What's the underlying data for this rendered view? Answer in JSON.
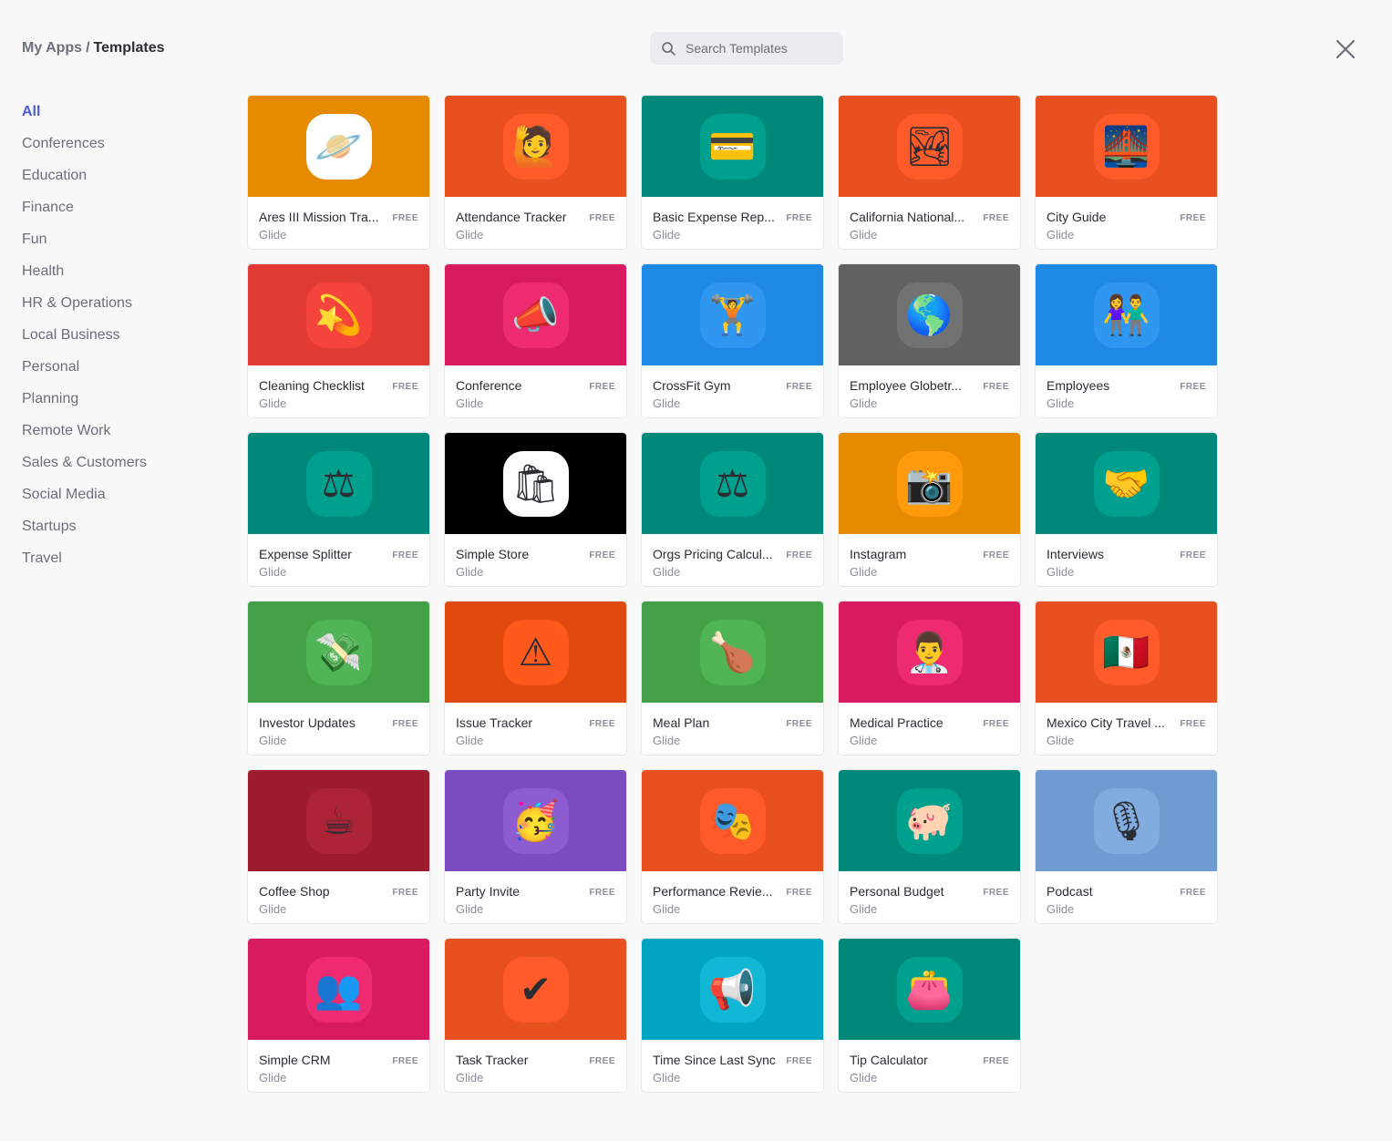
{
  "breadcrumb": {
    "parent": "My Apps",
    "separator": "/",
    "current": "Templates"
  },
  "search": {
    "placeholder": "Search Templates",
    "icon": "search-icon"
  },
  "close_icon": "close-icon",
  "sidebar": {
    "active_index": 0,
    "active_color": "#4f5bd5",
    "items": [
      "All",
      "Conferences",
      "Education",
      "Finance",
      "Fun",
      "Health",
      "HR & Operations",
      "Local Business",
      "Personal",
      "Planning",
      "Remote Work",
      "Sales & Customers",
      "Social Media",
      "Startups",
      "Travel"
    ]
  },
  "templates": [
    {
      "title": "Ares III Mission Tra...",
      "badge": "FREE",
      "author": "Glide",
      "color": "#e68a00",
      "tile": "#ffffff",
      "icon": "planet-icon",
      "glyph": "🪐"
    },
    {
      "title": "Attendance Tracker",
      "badge": "FREE",
      "author": "Glide",
      "color": "#e8501f",
      "tile": "#ff5a29",
      "icon": "person-raising-hand-icon",
      "glyph": "🙋"
    },
    {
      "title": "Basic Expense Rep...",
      "badge": "FREE",
      "author": "Glide",
      "color": "#00897b",
      "tile": "#00a08f",
      "icon": "credit-card-icon",
      "glyph": "💳"
    },
    {
      "title": "California National...",
      "badge": "FREE",
      "author": "Glide",
      "color": "#e8501f",
      "tile": "#ff5a29",
      "icon": "national-park-icon",
      "glyph": "🏞"
    },
    {
      "title": "City Guide",
      "badge": "FREE",
      "author": "Glide",
      "color": "#e8501f",
      "tile": "#ff5a29",
      "icon": "bridge-at-night-icon",
      "glyph": "🌉"
    },
    {
      "title": "Cleaning Checklist",
      "badge": "FREE",
      "author": "Glide",
      "color": "#e03a32",
      "tile": "#f4443c",
      "icon": "dizzy-star-icon",
      "glyph": "💫"
    },
    {
      "title": "Conference",
      "badge": "FREE",
      "author": "Glide",
      "color": "#d81b60",
      "tile": "#ee2a70",
      "icon": "megaphone-icon",
      "glyph": "📣"
    },
    {
      "title": "CrossFit Gym",
      "badge": "FREE",
      "author": "Glide",
      "color": "#1e88e5",
      "tile": "#2f97f0",
      "icon": "weight-lifter-icon",
      "glyph": "🏋"
    },
    {
      "title": "Employee Globetr...",
      "badge": "FREE",
      "author": "Glide",
      "color": "#616161",
      "tile": "#727272",
      "icon": "globe-icon",
      "glyph": "🌎"
    },
    {
      "title": "Employees",
      "badge": "FREE",
      "author": "Glide",
      "color": "#1e88e5",
      "tile": "#2f97f0",
      "icon": "people-holding-hands-icon",
      "glyph": "👫"
    },
    {
      "title": "Expense Splitter",
      "badge": "FREE",
      "author": "Glide",
      "color": "#00897b",
      "tile": "#00a08f",
      "icon": "balance-scale-icon",
      "glyph": "⚖"
    },
    {
      "title": "Simple Store",
      "badge": "FREE",
      "author": "Glide",
      "color": "#000000",
      "tile": "#ffffff",
      "icon": "shopping-bag-icon",
      "glyph": "🛍"
    },
    {
      "title": "Orgs Pricing Calcul...",
      "badge": "FREE",
      "author": "Glide",
      "color": "#00897b",
      "tile": "#00a08f",
      "icon": "balance-scale-icon",
      "glyph": "⚖"
    },
    {
      "title": "Instagram",
      "badge": "FREE",
      "author": "Glide",
      "color": "#e68a00",
      "tile": "#ff9a0a",
      "icon": "camera-flash-icon",
      "glyph": "📸"
    },
    {
      "title": "Interviews",
      "badge": "FREE",
      "author": "Glide",
      "color": "#00897b",
      "tile": "#00a08f",
      "icon": "handshake-icon",
      "glyph": "🤝"
    },
    {
      "title": "Investor Updates",
      "badge": "FREE",
      "author": "Glide",
      "color": "#43a047",
      "tile": "#51b456",
      "icon": "money-with-wings-icon",
      "glyph": "💸"
    },
    {
      "title": "Issue Tracker",
      "badge": "FREE",
      "author": "Glide",
      "color": "#e04a0f",
      "tile": "#ff5a1c",
      "icon": "warning-icon",
      "glyph": "⚠"
    },
    {
      "title": "Meal Plan",
      "badge": "FREE",
      "author": "Glide",
      "color": "#43a047",
      "tile": "#51b456",
      "icon": "poultry-leg-icon",
      "glyph": "🍗"
    },
    {
      "title": "Medical Practice",
      "badge": "FREE",
      "author": "Glide",
      "color": "#d81b60",
      "tile": "#ee2a70",
      "icon": "health-worker-icon",
      "glyph": "👨‍⚕️"
    },
    {
      "title": "Mexico City Travel ...",
      "badge": "FREE",
      "author": "Glide",
      "color": "#e8501f",
      "tile": "#ff5a29",
      "icon": "mexico-flag-icon",
      "glyph": "🇲🇽"
    },
    {
      "title": "Coffee Shop",
      "badge": "FREE",
      "author": "Glide",
      "color": "#9c1b2c",
      "tile": "#ae2437",
      "icon": "hot-beverage-icon",
      "glyph": "☕"
    },
    {
      "title": "Party Invite",
      "badge": "FREE",
      "author": "Glide",
      "color": "#7b4cbf",
      "tile": "#8c5cd0",
      "icon": "partying-face-icon",
      "glyph": "🥳"
    },
    {
      "title": "Performance Revie...",
      "badge": "FREE",
      "author": "Glide",
      "color": "#e8501f",
      "tile": "#ff5a29",
      "icon": "performing-arts-icon",
      "glyph": "🎭"
    },
    {
      "title": "Personal Budget",
      "badge": "FREE",
      "author": "Glide",
      "color": "#00897b",
      "tile": "#00a08f",
      "icon": "pig-icon",
      "glyph": "🐖"
    },
    {
      "title": "Podcast",
      "badge": "FREE",
      "author": "Glide",
      "color": "#6f9bd1",
      "tile": "#80acdf",
      "icon": "microphone-icon",
      "glyph": "🎙"
    },
    {
      "title": "Simple CRM",
      "badge": "FREE",
      "author": "Glide",
      "color": "#d81b60",
      "tile": "#ee2a70",
      "icon": "busts-in-silhouette-icon",
      "glyph": "👥"
    },
    {
      "title": "Task Tracker",
      "badge": "FREE",
      "author": "Glide",
      "color": "#e8501f",
      "tile": "#ff5a29",
      "icon": "check-mark-icon",
      "glyph": "✔"
    },
    {
      "title": "Time Since Last Sync",
      "badge": "FREE",
      "author": "Glide",
      "color": "#00a5c2",
      "tile": "#11b8d6",
      "icon": "loudspeaker-icon",
      "glyph": "📢"
    },
    {
      "title": "Tip Calculator",
      "badge": "FREE",
      "author": "Glide",
      "color": "#00897b",
      "tile": "#00a08f",
      "icon": "purse-icon",
      "glyph": "👛"
    }
  ]
}
